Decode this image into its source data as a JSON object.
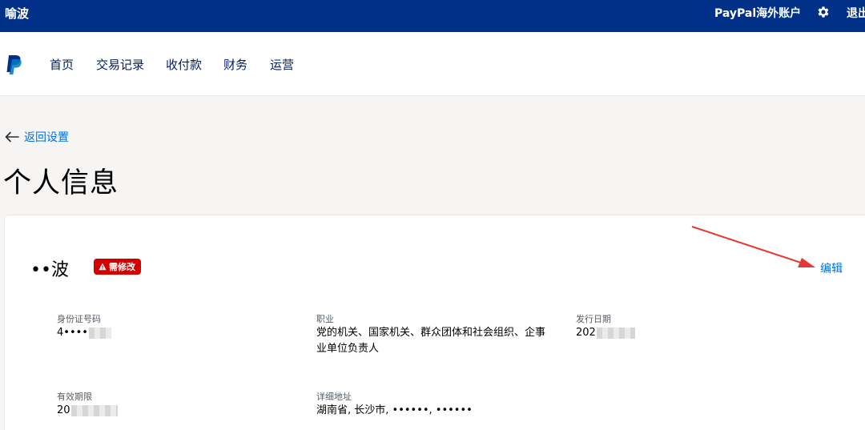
{
  "topbar": {
    "user_name": "喻波",
    "account_label": "PayPal海外账户",
    "logout_label": "退出"
  },
  "nav": {
    "items": [
      {
        "label": "首页"
      },
      {
        "label": "交易记录"
      },
      {
        "label": "收付款"
      },
      {
        "label": "财务"
      },
      {
        "label": "运营"
      }
    ]
  },
  "back_link": {
    "label": "返回设置"
  },
  "page_title": "个人信息",
  "profile": {
    "name": "••波",
    "status_badge": "需修改",
    "edit_label": "编辑",
    "fields": {
      "id_number": {
        "label": "身份证号码",
        "value": "4••••"
      },
      "occupation": {
        "label": "职业",
        "value": "党的机关、国家机关、群众团体和社会组织、企事业单位负责人"
      },
      "issue_date": {
        "label": "发行日期",
        "value": "202"
      },
      "valid_until": {
        "label": "有效期限",
        "value": "20"
      },
      "address": {
        "label": "详细地址",
        "value": "湖南省, 长沙市, ••••••, ••••••"
      }
    }
  },
  "colors": {
    "topbar_bg": "#003087",
    "link": "#0070e0",
    "badge_bg": "#d20000",
    "annotation_arrow": "#e53935"
  },
  "icons": {
    "logo": "paypal-logo",
    "settings": "gear-icon",
    "back": "arrow-left-icon",
    "warning": "warning-icon"
  }
}
